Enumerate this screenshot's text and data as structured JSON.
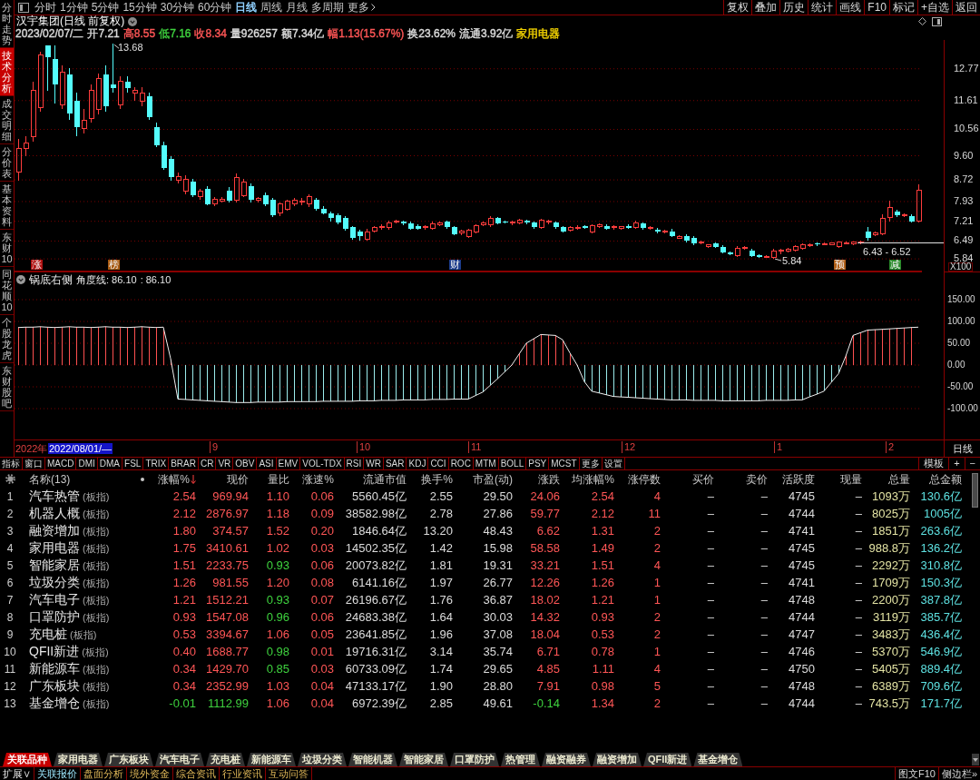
{
  "sidebar": {
    "items": [
      {
        "label": "分时走势",
        "selected": false
      },
      {
        "label": "技术分析",
        "selected": true
      },
      {
        "label": "成交明细",
        "selected": false
      },
      {
        "label": "分价表",
        "selected": false
      },
      {
        "label": "基本资料",
        "selected": false
      },
      {
        "label": "东财10",
        "selected": false
      },
      {
        "label": "同花顺10",
        "selected": false
      },
      {
        "label": "个股龙虎",
        "selected": false
      },
      {
        "label": "东财股吧",
        "selected": false
      }
    ]
  },
  "toolbar": {
    "periods": [
      {
        "label": "分时",
        "selected": false
      },
      {
        "label": "1分钟",
        "selected": false
      },
      {
        "label": "5分钟",
        "selected": false
      },
      {
        "label": "15分钟",
        "selected": false
      },
      {
        "label": "30分钟",
        "selected": false
      },
      {
        "label": "60分钟",
        "selected": false
      },
      {
        "label": "日线",
        "selected": true
      },
      {
        "label": "周线",
        "selected": false
      },
      {
        "label": "月线",
        "selected": false
      },
      {
        "label": "多周期",
        "selected": false
      }
    ],
    "more": "更多",
    "actions": [
      "复权",
      "叠加",
      "历史",
      "统计",
      "画线",
      "F10",
      "标记",
      "+自选",
      "返回"
    ]
  },
  "chart_header": {
    "title": "汉宇集团(日线 前复权)",
    "quote": [
      {
        "text": "2023/02/07/二",
        "color": "#dcdcdc"
      },
      {
        "text": "开7.21",
        "color": "#dcdcdc"
      },
      {
        "text": "高8.55",
        "color": "#ff5656"
      },
      {
        "text": "低7.16",
        "color": "#3ed23e"
      },
      {
        "text": "收8.34",
        "color": "#ff5656"
      },
      {
        "text": "量926257",
        "color": "#dcdcdc"
      },
      {
        "text": "额7.34亿",
        "color": "#dcdcdc"
      },
      {
        "text": "幅1.13(15.67%)",
        "color": "#ff5656"
      },
      {
        "text": "换23.62%",
        "color": "#dcdcdc"
      },
      {
        "text": "流通3.92亿",
        "color": "#dcdcdc"
      },
      {
        "text": "家用电器",
        "color": "#f2d200"
      }
    ]
  },
  "price_chart": {
    "high_label": "13.68",
    "low_label": "5.84",
    "range_label": "6.43 - 6.52",
    "scale_label": "X100",
    "markers": [
      {
        "text": "涨",
        "color": "#b01010"
      },
      {
        "text": "榜",
        "color": "#a85a10"
      },
      {
        "text": "财",
        "color": "#1c3c8c"
      },
      {
        "text": "预",
        "color": "#b06018"
      },
      {
        "text": "减",
        "color": "#2a8a2a"
      }
    ],
    "chart_data": {
      "type": "candlestick",
      "grid": true,
      "ylim": [
        5.38,
        13.82
      ],
      "yticks": [
        {
          "value": 12.77,
          "label": "12.77"
        },
        {
          "value": 11.61,
          "label": "11.61"
        },
        {
          "value": 10.56,
          "label": "10.56"
        },
        {
          "value": 9.6,
          "label": "9.60"
        },
        {
          "value": 8.72,
          "label": "8.72"
        },
        {
          "value": 7.93,
          "label": "7.93"
        },
        {
          "value": 7.21,
          "label": "7.21"
        },
        {
          "value": 6.49,
          "label": "6.49"
        },
        {
          "value": 5.84,
          "label": "5.84"
        }
      ],
      "ohlc": [
        [
          8.99,
          10.2,
          8.7,
          9.88
        ],
        [
          9.85,
          10.3,
          9.6,
          10.05
        ],
        [
          10.31,
          12.3,
          10.1,
          11.97
        ],
        [
          11.37,
          13.4,
          11.2,
          13.29
        ],
        [
          13.62,
          13.62,
          11.97,
          13.19
        ],
        [
          13.12,
          13.62,
          11.5,
          12.2
        ],
        [
          11.47,
          12.9,
          11.3,
          12.63
        ],
        [
          12.56,
          12.8,
          10.9,
          11.14
        ],
        [
          11.6,
          11.9,
          10.3,
          10.64
        ],
        [
          10.6,
          11.3,
          10.4,
          10.9
        ],
        [
          10.97,
          12.2,
          10.8,
          11.97
        ],
        [
          11.3,
          12.6,
          11.1,
          12.4
        ],
        [
          12.56,
          12.9,
          11.2,
          11.4
        ],
        [
          12.2,
          13.68,
          11.9,
          12.07
        ],
        [
          11.47,
          12.5,
          11.3,
          12.3
        ],
        [
          12.3,
          12.5,
          11.9,
          12.07
        ],
        [
          11.9,
          12.1,
          11.6,
          11.97
        ],
        [
          11.57,
          12.1,
          11.4,
          11.9
        ],
        [
          11.77,
          11.9,
          10.9,
          11.0
        ],
        [
          10.64,
          10.8,
          9.9,
          9.98
        ],
        [
          9.98,
          10.1,
          9.1,
          9.15
        ],
        [
          9.48,
          9.6,
          8.7,
          8.82
        ],
        [
          8.7,
          9.0,
          8.6,
          8.85
        ],
        [
          8.32,
          8.9,
          8.2,
          8.75
        ],
        [
          8.65,
          8.75,
          8.1,
          8.16
        ],
        [
          8.1,
          8.4,
          8.0,
          8.3
        ],
        [
          8.39,
          8.5,
          7.8,
          7.83
        ],
        [
          7.83,
          8.1,
          7.75,
          8.0
        ],
        [
          7.95,
          8.1,
          7.9,
          8.02
        ],
        [
          8.32,
          8.45,
          7.9,
          7.95
        ],
        [
          7.99,
          8.95,
          7.9,
          8.82
        ],
        [
          8.16,
          8.75,
          8.1,
          8.65
        ],
        [
          8.49,
          8.6,
          7.9,
          7.99
        ],
        [
          7.98,
          8.1,
          7.9,
          8.05
        ],
        [
          8.16,
          8.25,
          7.75,
          7.83
        ],
        [
          7.99,
          8.05,
          7.36,
          7.43
        ],
        [
          7.5,
          7.9,
          7.4,
          7.83
        ],
        [
          7.66,
          8.0,
          7.6,
          7.95
        ],
        [
          7.83,
          8.05,
          7.75,
          7.99
        ],
        [
          7.9,
          8.06,
          7.8,
          7.96
        ],
        [
          7.83,
          8.2,
          7.74,
          8.1
        ],
        [
          7.99,
          8.05,
          7.6,
          7.66
        ],
        [
          7.66,
          7.75,
          7.45,
          7.5
        ],
        [
          7.5,
          7.55,
          7.2,
          7.33
        ],
        [
          7.43,
          7.5,
          7.1,
          7.16
        ],
        [
          7.33,
          7.4,
          6.86,
          6.93
        ],
        [
          7.0,
          7.05,
          6.55,
          6.6
        ],
        [
          6.83,
          6.9,
          6.5,
          6.67
        ],
        [
          6.57,
          6.95,
          6.5,
          6.83
        ],
        [
          6.85,
          7.05,
          6.8,
          6.98
        ],
        [
          6.98,
          7.1,
          6.9,
          7.02
        ],
        [
          6.98,
          7.25,
          6.9,
          7.16
        ],
        [
          7.18,
          7.28,
          7.12,
          7.22
        ],
        [
          7.2,
          7.25,
          7.08,
          7.12
        ],
        [
          7.12,
          7.2,
          6.9,
          6.95
        ],
        [
          7.05,
          7.1,
          6.9,
          6.93
        ],
        [
          6.97,
          7.06,
          6.9,
          7.01
        ],
        [
          6.95,
          7.2,
          6.9,
          7.12
        ],
        [
          7.1,
          7.2,
          7.05,
          7.15
        ],
        [
          7.2,
          7.25,
          6.95,
          6.99
        ],
        [
          6.99,
          7.05,
          6.7,
          6.73
        ],
        [
          6.78,
          6.9,
          6.72,
          6.84
        ],
        [
          6.67,
          6.95,
          6.6,
          6.9
        ],
        [
          6.83,
          7.1,
          6.76,
          7.05
        ],
        [
          7.1,
          7.2,
          7.03,
          7.16
        ],
        [
          7.07,
          7.4,
          7.0,
          7.33
        ],
        [
          7.33,
          7.38,
          7.1,
          7.14
        ],
        [
          7.2,
          7.25,
          7.12,
          7.16
        ],
        [
          7.14,
          7.24,
          7.08,
          7.19
        ],
        [
          7.16,
          7.3,
          7.1,
          7.26
        ],
        [
          7.22,
          7.28,
          7.1,
          7.16
        ],
        [
          7.16,
          7.2,
          6.95,
          7.0
        ],
        [
          7.0,
          7.3,
          6.95,
          7.26
        ],
        [
          7.17,
          7.26,
          7.1,
          7.21
        ],
        [
          7.16,
          7.2,
          6.95,
          6.99
        ],
        [
          7.0,
          7.05,
          6.8,
          6.85
        ],
        [
          6.9,
          7.05,
          6.85,
          6.99
        ],
        [
          6.96,
          7.06,
          6.9,
          7.0
        ],
        [
          7.03,
          7.08,
          6.92,
          6.97
        ],
        [
          6.83,
          7.1,
          6.76,
          7.05
        ],
        [
          7.02,
          7.12,
          6.96,
          7.07
        ],
        [
          7.05,
          7.11,
          6.9,
          6.95
        ],
        [
          6.97,
          7.07,
          6.91,
          7.02
        ],
        [
          6.95,
          7.05,
          6.9,
          7.02
        ],
        [
          7.03,
          7.09,
          6.94,
          6.98
        ],
        [
          6.99,
          7.22,
          6.95,
          7.16
        ],
        [
          7.12,
          7.18,
          6.9,
          6.97
        ],
        [
          6.95,
          7.03,
          6.9,
          6.99
        ],
        [
          6.9,
          6.96,
          6.76,
          6.83
        ],
        [
          6.81,
          6.9,
          6.76,
          6.85
        ],
        [
          6.85,
          6.92,
          6.65,
          6.68
        ],
        [
          6.6,
          6.72,
          6.56,
          6.67
        ],
        [
          6.67,
          6.74,
          6.45,
          6.5
        ],
        [
          6.6,
          6.66,
          6.35,
          6.4
        ],
        [
          6.41,
          6.5,
          6.36,
          6.46
        ],
        [
          6.3,
          6.38,
          6.25,
          6.34
        ],
        [
          6.4,
          6.45,
          6.24,
          6.27
        ],
        [
          6.27,
          6.33,
          6.05,
          6.07
        ],
        [
          6.07,
          6.12,
          5.98,
          6.02
        ],
        [
          5.97,
          6.3,
          5.9,
          6.24
        ],
        [
          6.21,
          6.3,
          6.16,
          6.25
        ],
        [
          6.14,
          6.2,
          5.9,
          5.94
        ],
        [
          5.97,
          6.02,
          5.87,
          5.91
        ],
        [
          5.9,
          5.98,
          5.86,
          5.94
        ],
        [
          5.9,
          6.2,
          5.84,
          6.14
        ],
        [
          6.12,
          6.2,
          6.02,
          6.15
        ],
        [
          6.14,
          6.25,
          6.09,
          6.2
        ],
        [
          6.17,
          6.33,
          6.11,
          6.3
        ],
        [
          6.24,
          6.39,
          6.19,
          6.34
        ],
        [
          6.31,
          6.41,
          6.27,
          6.37
        ],
        [
          6.41,
          6.45,
          6.31,
          6.36
        ],
        [
          6.37,
          6.43,
          6.33,
          6.39
        ],
        [
          6.37,
          6.45,
          6.33,
          6.41
        ],
        [
          6.3,
          6.46,
          6.24,
          6.44
        ],
        [
          6.41,
          6.47,
          6.37,
          6.43
        ],
        [
          6.38,
          6.48,
          6.33,
          6.44
        ],
        [
          6.42,
          6.49,
          6.38,
          6.45
        ],
        [
          6.83,
          7.0,
          6.52,
          6.6
        ],
        [
          6.73,
          6.85,
          6.68,
          6.8
        ],
        [
          6.77,
          7.45,
          6.7,
          7.33
        ],
        [
          7.36,
          7.95,
          7.2,
          7.7
        ],
        [
          7.56,
          7.62,
          7.35,
          7.43
        ],
        [
          7.41,
          7.5,
          7.36,
          7.45
        ],
        [
          7.4,
          7.45,
          7.18,
          7.2
        ],
        [
          7.21,
          8.55,
          7.16,
          8.34
        ]
      ]
    }
  },
  "indicator": {
    "name": "锅底右侧",
    "line_label": "角度线: 86.10",
    "value_label": ": 86.10",
    "chart_data": {
      "type": "area",
      "grid": true,
      "ylim": [
        -170.8,
        214.6
      ],
      "yticks": [
        {
          "value": 150,
          "label": "150.00"
        },
        {
          "value": 100,
          "label": "100.00"
        },
        {
          "value": 50,
          "label": "50.00"
        },
        {
          "value": 0,
          "label": "0.00"
        },
        {
          "value": -50,
          "label": "-50.00"
        },
        {
          "value": -100,
          "label": "-100.00"
        }
      ],
      "series": [
        {
          "color": "#f0f0f0",
          "values": [
            86,
            87,
            87,
            88,
            87,
            86,
            87,
            88,
            87,
            87,
            86,
            87,
            88,
            87,
            87,
            86,
            87,
            88,
            87,
            86,
            87,
            15,
            -78,
            -79,
            -80,
            -81,
            -82,
            -83,
            -84,
            -85,
            -86,
            -86,
            -86,
            -85,
            -85,
            -85,
            -85,
            -84,
            -84,
            -84,
            -84,
            -84,
            -83,
            -83,
            -83,
            -83,
            -83,
            -82,
            -82,
            -82,
            -81,
            -81,
            -81,
            -80,
            -80,
            -80,
            -80,
            -79,
            -79,
            -79,
            -78,
            -78,
            -78,
            -70,
            -62,
            -47,
            -32,
            -16,
            0,
            25,
            50,
            60,
            70,
            69,
            68,
            58,
            28,
            0,
            -38,
            -60,
            -64,
            -68,
            -72,
            -73,
            -74,
            -75,
            -76,
            -77,
            -78,
            -79,
            -80,
            -80,
            -80,
            -81,
            -81,
            -81,
            -81,
            -82,
            -82,
            -82,
            -82,
            -82,
            -82,
            -81,
            -81,
            -81,
            -81,
            -80,
            -80,
            -73,
            -67,
            -60,
            -40,
            -20,
            20,
            68,
            74,
            80,
            81,
            82,
            83,
            84,
            85,
            86,
            87
          ]
        }
      ]
    }
  },
  "date_axis": {
    "year": "2022年",
    "cursor_date": "2022/08/01/—",
    "months": [
      "9",
      "10",
      "11",
      "12",
      "1",
      "2"
    ],
    "period": "日线"
  },
  "indicator_tabs": {
    "items": [
      "指标",
      "窗口",
      "MACD",
      "DMI",
      "DMA",
      "FSL",
      "TRIX",
      "BRAR",
      "CR",
      "VR",
      "OBV",
      "ASI",
      "EMV",
      "VOL-TDX",
      "RSI",
      "WR",
      "SAR",
      "KDJ",
      "CCI",
      "ROC",
      "MTM",
      "BOLL",
      "PSY",
      "MCST",
      "更多",
      "设置"
    ],
    "actions": [
      "模板",
      "+",
      "−"
    ]
  },
  "table": {
    "name_header": "名称(13)",
    "columns": [
      {
        "label": "涨幅%",
        "sorted": true
      },
      {
        "label": "现价",
        "sorted": false
      },
      {
        "label": "量比",
        "sorted": false
      },
      {
        "label": "涨速%",
        "sorted": false
      },
      {
        "label": "流通市值",
        "sorted": false
      },
      {
        "label": "换手%",
        "sorted": false
      },
      {
        "label": "市盈(动)",
        "sorted": false
      },
      {
        "label": "涨跌",
        "sorted": false
      },
      {
        "label": "均涨幅%",
        "sorted": false
      },
      {
        "label": "涨停数",
        "sorted": false
      },
      {
        "label": "买价",
        "sorted": false
      },
      {
        "label": "卖价",
        "sorted": false
      },
      {
        "label": "活跃度",
        "sorted": false
      },
      {
        "label": "现量",
        "sorted": false
      },
      {
        "label": "总量",
        "sorted": false
      },
      {
        "label": "总金额",
        "sorted": false
      }
    ],
    "rows": [
      {
        "index": "1",
        "name": "汽车热管",
        "tag": "(板指)",
        "cells": [
          {
            "text": "2.54",
            "color": "#ff5656"
          },
          {
            "text": "969.94",
            "color": "#ff5656"
          },
          {
            "text": "1.10",
            "color": "#ff5656"
          },
          {
            "text": "0.06",
            "color": "#ff5656"
          },
          {
            "text": "5560.45亿",
            "color": "#dcdcdc"
          },
          {
            "text": "2.55",
            "color": "#dcdcdc"
          },
          {
            "text": "29.50",
            "color": "#dcdcdc"
          },
          {
            "text": "24.06",
            "color": "#ff5656"
          },
          {
            "text": "2.54",
            "color": "#ff5656"
          },
          {
            "text": "4",
            "color": "#ff5656"
          },
          {
            "text": "–"
          },
          {
            "text": "–"
          },
          {
            "text": "4745",
            "color": "#dcdcdc"
          },
          {
            "text": "–"
          },
          {
            "text": "1093万",
            "color": "#e4e4a4"
          },
          {
            "text": "130.6亿",
            "color": "#5ee2e2"
          }
        ]
      },
      {
        "index": "2",
        "name": "机器人概",
        "tag": "(板指)",
        "cells": [
          {
            "text": "2.12",
            "color": "#ff5656"
          },
          {
            "text": "2876.97",
            "color": "#ff5656"
          },
          {
            "text": "1.18",
            "color": "#ff5656"
          },
          {
            "text": "0.09",
            "color": "#ff5656"
          },
          {
            "text": "38582.98亿",
            "color": "#dcdcdc"
          },
          {
            "text": "2.78",
            "color": "#dcdcdc"
          },
          {
            "text": "27.86",
            "color": "#dcdcdc"
          },
          {
            "text": "59.77",
            "color": "#ff5656"
          },
          {
            "text": "2.12",
            "color": "#ff5656"
          },
          {
            "text": "11",
            "color": "#ff5656"
          },
          {
            "text": "–"
          },
          {
            "text": "–"
          },
          {
            "text": "4744",
            "color": "#dcdcdc"
          },
          {
            "text": "–"
          },
          {
            "text": "8025万",
            "color": "#e4e4a4"
          },
          {
            "text": "1005亿",
            "color": "#5ee2e2"
          }
        ]
      },
      {
        "index": "3",
        "name": "融资增加",
        "tag": "(板指)",
        "cells": [
          {
            "text": "1.80",
            "color": "#ff5656"
          },
          {
            "text": "374.57",
            "color": "#ff5656"
          },
          {
            "text": "1.52",
            "color": "#ff5656"
          },
          {
            "text": "0.20",
            "color": "#ff5656"
          },
          {
            "text": "1846.64亿",
            "color": "#dcdcdc"
          },
          {
            "text": "13.20",
            "color": "#dcdcdc"
          },
          {
            "text": "48.43",
            "color": "#dcdcdc"
          },
          {
            "text": "6.62",
            "color": "#ff5656"
          },
          {
            "text": "1.31",
            "color": "#ff5656"
          },
          {
            "text": "2",
            "color": "#ff5656"
          },
          {
            "text": "–"
          },
          {
            "text": "–"
          },
          {
            "text": "4741",
            "color": "#dcdcdc"
          },
          {
            "text": "–"
          },
          {
            "text": "1851万",
            "color": "#e4e4a4"
          },
          {
            "text": "263.6亿",
            "color": "#5ee2e2"
          }
        ]
      },
      {
        "index": "4",
        "name": "家用电器",
        "tag": "(板指)",
        "cells": [
          {
            "text": "1.75",
            "color": "#ff5656"
          },
          {
            "text": "3410.61",
            "color": "#ff5656"
          },
          {
            "text": "1.02",
            "color": "#ff5656"
          },
          {
            "text": "0.03",
            "color": "#ff5656"
          },
          {
            "text": "14502.35亿",
            "color": "#dcdcdc"
          },
          {
            "text": "1.42",
            "color": "#dcdcdc"
          },
          {
            "text": "15.98",
            "color": "#dcdcdc"
          },
          {
            "text": "58.58",
            "color": "#ff5656"
          },
          {
            "text": "1.49",
            "color": "#ff5656"
          },
          {
            "text": "2",
            "color": "#ff5656"
          },
          {
            "text": "–"
          },
          {
            "text": "–"
          },
          {
            "text": "4745",
            "color": "#dcdcdc"
          },
          {
            "text": "–"
          },
          {
            "text": "988.8万",
            "color": "#e4e4a4"
          },
          {
            "text": "136.2亿",
            "color": "#5ee2e2"
          }
        ]
      },
      {
        "index": "5",
        "name": "智能家居",
        "tag": "(板指)",
        "cells": [
          {
            "text": "1.51",
            "color": "#ff5656"
          },
          {
            "text": "2233.75",
            "color": "#ff5656"
          },
          {
            "text": "0.93",
            "color": "#3ed23e"
          },
          {
            "text": "0.06",
            "color": "#ff5656"
          },
          {
            "text": "20073.82亿",
            "color": "#dcdcdc"
          },
          {
            "text": "1.81",
            "color": "#dcdcdc"
          },
          {
            "text": "19.31",
            "color": "#dcdcdc"
          },
          {
            "text": "33.21",
            "color": "#ff5656"
          },
          {
            "text": "1.51",
            "color": "#ff5656"
          },
          {
            "text": "4",
            "color": "#ff5656"
          },
          {
            "text": "–"
          },
          {
            "text": "–"
          },
          {
            "text": "4745",
            "color": "#dcdcdc"
          },
          {
            "text": "–"
          },
          {
            "text": "2292万",
            "color": "#e4e4a4"
          },
          {
            "text": "310.8亿",
            "color": "#5ee2e2"
          }
        ]
      },
      {
        "index": "6",
        "name": "垃圾分类",
        "tag": "(板指)",
        "cells": [
          {
            "text": "1.26",
            "color": "#ff5656"
          },
          {
            "text": "981.55",
            "color": "#ff5656"
          },
          {
            "text": "1.20",
            "color": "#ff5656"
          },
          {
            "text": "0.08",
            "color": "#ff5656"
          },
          {
            "text": "6141.16亿",
            "color": "#dcdcdc"
          },
          {
            "text": "1.97",
            "color": "#dcdcdc"
          },
          {
            "text": "26.77",
            "color": "#dcdcdc"
          },
          {
            "text": "12.26",
            "color": "#ff5656"
          },
          {
            "text": "1.26",
            "color": "#ff5656"
          },
          {
            "text": "1",
            "color": "#ff5656"
          },
          {
            "text": "–"
          },
          {
            "text": "–"
          },
          {
            "text": "4741",
            "color": "#dcdcdc"
          },
          {
            "text": "–"
          },
          {
            "text": "1709万",
            "color": "#e4e4a4"
          },
          {
            "text": "150.3亿",
            "color": "#5ee2e2"
          }
        ]
      },
      {
        "index": "7",
        "name": "汽车电子",
        "tag": "(板指)",
        "cells": [
          {
            "text": "1.21",
            "color": "#ff5656"
          },
          {
            "text": "1512.21",
            "color": "#ff5656"
          },
          {
            "text": "0.93",
            "color": "#3ed23e"
          },
          {
            "text": "0.07",
            "color": "#ff5656"
          },
          {
            "text": "26196.67亿",
            "color": "#dcdcdc"
          },
          {
            "text": "1.76",
            "color": "#dcdcdc"
          },
          {
            "text": "36.87",
            "color": "#dcdcdc"
          },
          {
            "text": "18.02",
            "color": "#ff5656"
          },
          {
            "text": "1.21",
            "color": "#ff5656"
          },
          {
            "text": "1",
            "color": "#ff5656"
          },
          {
            "text": "–"
          },
          {
            "text": "–"
          },
          {
            "text": "4748",
            "color": "#dcdcdc"
          },
          {
            "text": "–"
          },
          {
            "text": "2200万",
            "color": "#e4e4a4"
          },
          {
            "text": "387.8亿",
            "color": "#5ee2e2"
          }
        ]
      },
      {
        "index": "8",
        "name": "口罩防护",
        "tag": "(板指)",
        "cells": [
          {
            "text": "0.93",
            "color": "#ff5656"
          },
          {
            "text": "1547.08",
            "color": "#ff5656"
          },
          {
            "text": "0.96",
            "color": "#3ed23e"
          },
          {
            "text": "0.06",
            "color": "#ff5656"
          },
          {
            "text": "24683.38亿",
            "color": "#dcdcdc"
          },
          {
            "text": "1.64",
            "color": "#dcdcdc"
          },
          {
            "text": "30.03",
            "color": "#dcdcdc"
          },
          {
            "text": "14.32",
            "color": "#ff5656"
          },
          {
            "text": "0.93",
            "color": "#ff5656"
          },
          {
            "text": "2",
            "color": "#ff5656"
          },
          {
            "text": "–"
          },
          {
            "text": "–"
          },
          {
            "text": "4744",
            "color": "#dcdcdc"
          },
          {
            "text": "–"
          },
          {
            "text": "3119万",
            "color": "#e4e4a4"
          },
          {
            "text": "385.7亿",
            "color": "#5ee2e2"
          }
        ]
      },
      {
        "index": "9",
        "name": "充电桩",
        "tag": "(板指)",
        "cells": [
          {
            "text": "0.53",
            "color": "#ff5656"
          },
          {
            "text": "3394.67",
            "color": "#ff5656"
          },
          {
            "text": "1.06",
            "color": "#ff5656"
          },
          {
            "text": "0.05",
            "color": "#ff5656"
          },
          {
            "text": "23641.85亿",
            "color": "#dcdcdc"
          },
          {
            "text": "1.96",
            "color": "#dcdcdc"
          },
          {
            "text": "37.08",
            "color": "#dcdcdc"
          },
          {
            "text": "18.04",
            "color": "#ff5656"
          },
          {
            "text": "0.53",
            "color": "#ff5656"
          },
          {
            "text": "2",
            "color": "#ff5656"
          },
          {
            "text": "–"
          },
          {
            "text": "–"
          },
          {
            "text": "4747",
            "color": "#dcdcdc"
          },
          {
            "text": "–"
          },
          {
            "text": "3483万",
            "color": "#e4e4a4"
          },
          {
            "text": "436.4亿",
            "color": "#5ee2e2"
          }
        ]
      },
      {
        "index": "10",
        "name": "QFII新进",
        "tag": "(板指)",
        "cells": [
          {
            "text": "0.40",
            "color": "#ff5656"
          },
          {
            "text": "1688.77",
            "color": "#ff5656"
          },
          {
            "text": "0.98",
            "color": "#3ed23e"
          },
          {
            "text": "0.01",
            "color": "#ff5656"
          },
          {
            "text": "19716.31亿",
            "color": "#dcdcdc"
          },
          {
            "text": "3.14",
            "color": "#dcdcdc"
          },
          {
            "text": "35.74",
            "color": "#dcdcdc"
          },
          {
            "text": "6.71",
            "color": "#ff5656"
          },
          {
            "text": "0.78",
            "color": "#ff5656"
          },
          {
            "text": "1",
            "color": "#ff5656"
          },
          {
            "text": "–"
          },
          {
            "text": "–"
          },
          {
            "text": "4746",
            "color": "#dcdcdc"
          },
          {
            "text": "–"
          },
          {
            "text": "5370万",
            "color": "#e4e4a4"
          },
          {
            "text": "546.9亿",
            "color": "#5ee2e2"
          }
        ]
      },
      {
        "index": "11",
        "name": "新能源车",
        "tag": "(板指)",
        "cells": [
          {
            "text": "0.34",
            "color": "#ff5656"
          },
          {
            "text": "1429.70",
            "color": "#ff5656"
          },
          {
            "text": "0.85",
            "color": "#3ed23e"
          },
          {
            "text": "0.03",
            "color": "#ff5656"
          },
          {
            "text": "60733.09亿",
            "color": "#dcdcdc"
          },
          {
            "text": "1.74",
            "color": "#dcdcdc"
          },
          {
            "text": "29.65",
            "color": "#dcdcdc"
          },
          {
            "text": "4.85",
            "color": "#ff5656"
          },
          {
            "text": "1.11",
            "color": "#ff5656"
          },
          {
            "text": "4",
            "color": "#ff5656"
          },
          {
            "text": "–"
          },
          {
            "text": "–"
          },
          {
            "text": "4750",
            "color": "#dcdcdc"
          },
          {
            "text": "–"
          },
          {
            "text": "5405万",
            "color": "#e4e4a4"
          },
          {
            "text": "889.4亿",
            "color": "#5ee2e2"
          }
        ]
      },
      {
        "index": "12",
        "name": "广东板块",
        "tag": "(板指)",
        "cells": [
          {
            "text": "0.34",
            "color": "#ff5656"
          },
          {
            "text": "2352.99",
            "color": "#ff5656"
          },
          {
            "text": "1.03",
            "color": "#ff5656"
          },
          {
            "text": "0.04",
            "color": "#ff5656"
          },
          {
            "text": "47133.17亿",
            "color": "#dcdcdc"
          },
          {
            "text": "1.90",
            "color": "#dcdcdc"
          },
          {
            "text": "28.80",
            "color": "#dcdcdc"
          },
          {
            "text": "7.91",
            "color": "#ff5656"
          },
          {
            "text": "0.98",
            "color": "#ff5656"
          },
          {
            "text": "5",
            "color": "#ff5656"
          },
          {
            "text": "–"
          },
          {
            "text": "–"
          },
          {
            "text": "4748",
            "color": "#dcdcdc"
          },
          {
            "text": "–"
          },
          {
            "text": "6389万",
            "color": "#e4e4a4"
          },
          {
            "text": "709.6亿",
            "color": "#5ee2e2"
          }
        ]
      },
      {
        "index": "13",
        "name": "基金增仓",
        "tag": "(板指)",
        "cells": [
          {
            "text": "-0.01",
            "color": "#3ed23e"
          },
          {
            "text": "1112.99",
            "color": "#3ed23e"
          },
          {
            "text": "1.06",
            "color": "#ff5656"
          },
          {
            "text": "0.04",
            "color": "#ff5656"
          },
          {
            "text": "6972.39亿",
            "color": "#dcdcdc"
          },
          {
            "text": "2.85",
            "color": "#dcdcdc"
          },
          {
            "text": "49.61",
            "color": "#dcdcdc"
          },
          {
            "text": "-0.14",
            "color": "#3ed23e"
          },
          {
            "text": "1.34",
            "color": "#ff5656"
          },
          {
            "text": "2",
            "color": "#ff5656"
          },
          {
            "text": "–"
          },
          {
            "text": "–"
          },
          {
            "text": "4744",
            "color": "#dcdcdc"
          },
          {
            "text": "–"
          },
          {
            "text": "743.5万",
            "color": "#e4e4a4"
          },
          {
            "text": "171.7亿",
            "color": "#5ee2e2"
          }
        ]
      }
    ]
  },
  "bottom_tabs": {
    "items": [
      {
        "label": "关联品种",
        "selected": true
      },
      {
        "label": "家用电器",
        "selected": false
      },
      {
        "label": "广东板块",
        "selected": false
      },
      {
        "label": "汽车电子",
        "selected": false
      },
      {
        "label": "充电桩",
        "selected": false
      },
      {
        "label": "新能源车",
        "selected": false
      },
      {
        "label": "垃圾分类",
        "selected": false
      },
      {
        "label": "智能机器",
        "selected": false
      },
      {
        "label": "智能家居",
        "selected": false
      },
      {
        "label": "口罩防护",
        "selected": false
      },
      {
        "label": "热管理",
        "selected": false
      },
      {
        "label": "融资融券",
        "selected": false
      },
      {
        "label": "融资增加",
        "selected": false
      },
      {
        "label": "QFII新进",
        "selected": false
      },
      {
        "label": "基金增仓",
        "selected": false
      }
    ]
  },
  "footer": {
    "expand": "扩展∨",
    "links": [
      {
        "label": "关联报价",
        "selected": true
      },
      {
        "label": "盘面分析",
        "selected": false
      },
      {
        "label": "境外资金",
        "selected": false
      },
      {
        "label": "综合资讯",
        "selected": false
      },
      {
        "label": "行业资讯",
        "selected": false
      },
      {
        "label": "互动问答",
        "selected": false
      }
    ],
    "right": [
      "图文F10",
      "侧边栏»"
    ]
  }
}
